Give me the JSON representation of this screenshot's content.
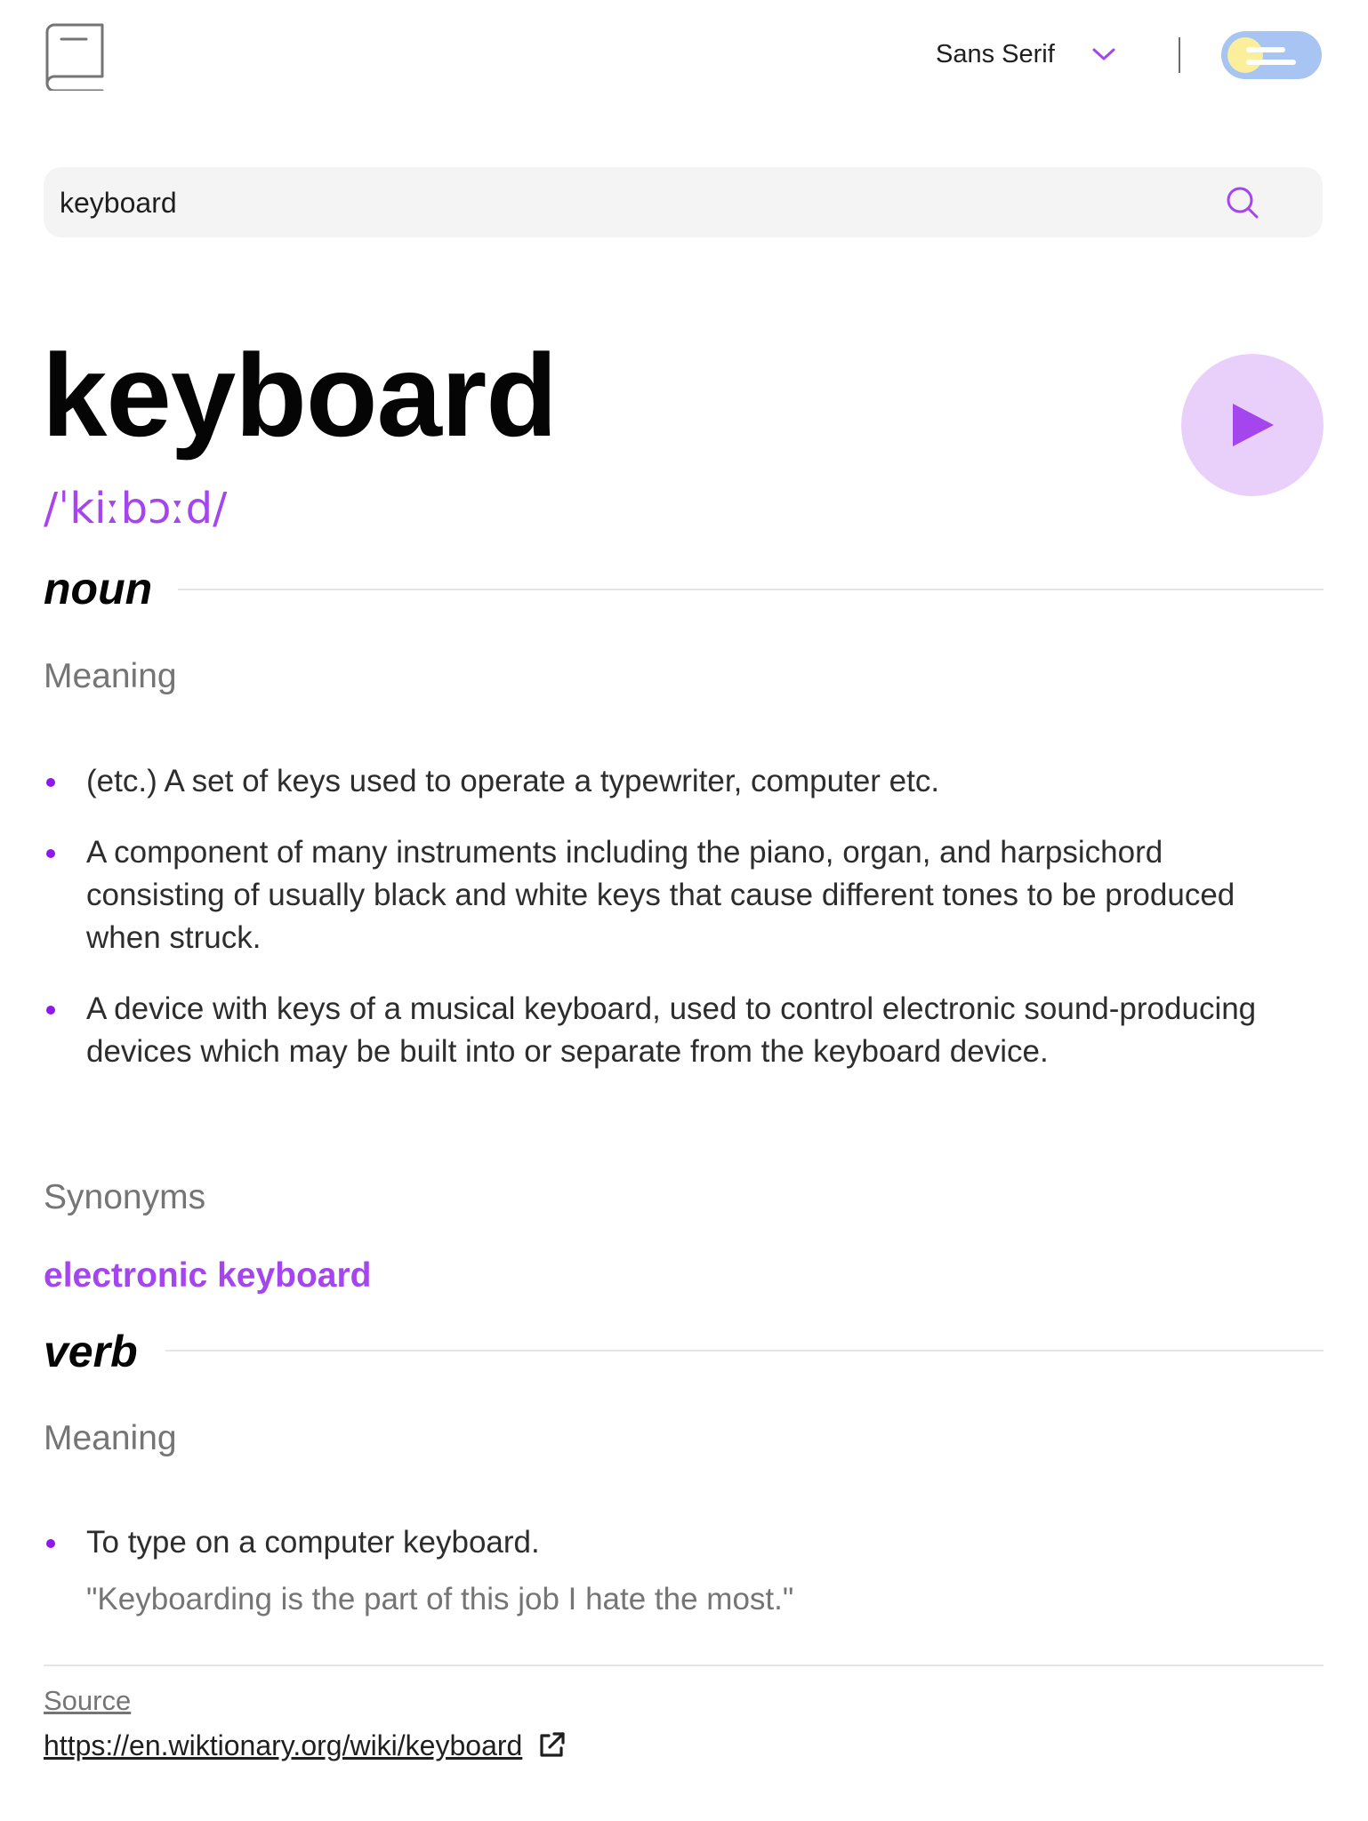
{
  "header": {
    "logo_icon": "book-icon",
    "font_selector": {
      "selected": "Sans Serif",
      "icon": "chevron-down-icon"
    },
    "theme_toggle": {
      "state": "light",
      "icon": "toggle-icon"
    }
  },
  "search": {
    "value": "keyboard",
    "placeholder": "",
    "icon": "search-icon"
  },
  "entry": {
    "word": "keyboard",
    "phonetic": "/ˈkiːbɔːd/",
    "play_icon": "play-icon",
    "meanings": [
      {
        "part_of_speech": "noun",
        "meaning_label": "Meaning",
        "definitions": [
          "(etc.) A set of keys used to operate a typewriter, computer etc.",
          "A component of many instruments including the piano, organ, and harpsichord consisting of usually black and white keys that cause different tones to be produced when struck.",
          "A device with keys of a musical keyboard, used to control electronic sound-producing devices which may be built into or separate from the keyboard device."
        ],
        "synonyms_label": "Synonyms",
        "synonyms": [
          "electronic keyboard"
        ]
      },
      {
        "part_of_speech": "verb",
        "meaning_label": "Meaning",
        "definitions": [
          {
            "text": "To type on a computer keyboard.",
            "example": "\"Keyboarding is the part of this job I hate the most.\""
          }
        ]
      }
    ]
  },
  "source": {
    "label": "Source",
    "url": "https://en.wiktionary.org/wiki/keyboard",
    "icon": "external-link-icon"
  },
  "colors": {
    "accent": "#A445ED",
    "bullet": "#8F19E8",
    "play_bg": "#E9D0FA",
    "search_bg": "#F4F4F4",
    "toggle_bg": "#A7C4F2",
    "toggle_knob": "#FBEF9B",
    "muted_text": "#757575",
    "heading": "#050505"
  }
}
